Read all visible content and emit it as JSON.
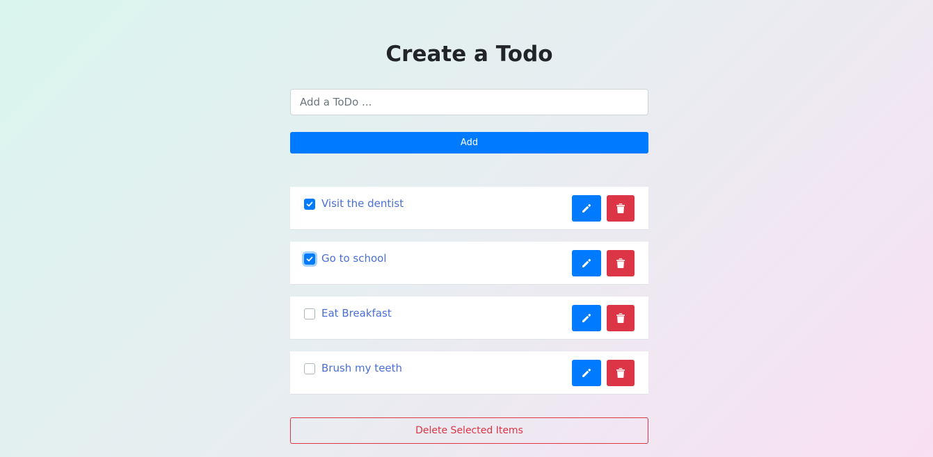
{
  "page": {
    "title": "Create a Todo"
  },
  "form": {
    "input_placeholder": "Add a ToDo ...",
    "input_value": "",
    "add_label": "Add"
  },
  "todos": [
    {
      "text": "Visit the dentist",
      "checked": true,
      "focused": false
    },
    {
      "text": "Go to school",
      "checked": true,
      "focused": true
    },
    {
      "text": "Eat Breakfast",
      "checked": false,
      "focused": false
    },
    {
      "text": "Brush my teeth",
      "checked": false,
      "focused": false
    }
  ],
  "item_icons": {
    "edit": "pencil-icon",
    "delete": "trash-icon",
    "check": "checkmark-icon"
  },
  "actions": {
    "delete_selected_label": "Delete Selected Items"
  },
  "colors": {
    "primary": "#007bff",
    "danger": "#dc3545",
    "item_text": "#4a6fd6"
  }
}
